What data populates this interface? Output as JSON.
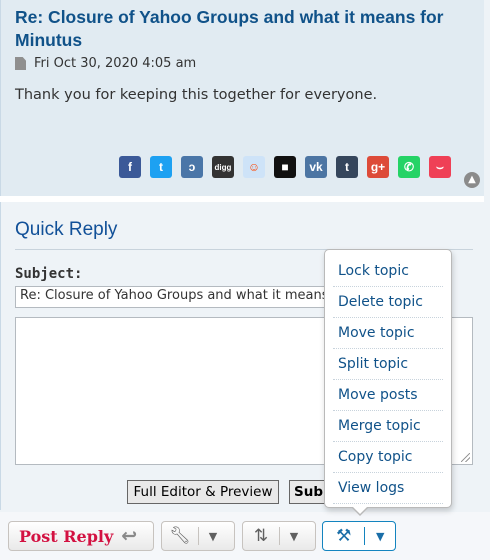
{
  "post": {
    "title": "Re: Closure of Yahoo Groups and what it means for Minutus",
    "date": "Fri Oct 30, 2020 4:05 am",
    "body": "Thank you for keeping this together for everyone."
  },
  "share": [
    {
      "name": "facebook-icon",
      "glyph": "f",
      "color": "#3b5998"
    },
    {
      "name": "twitter-icon",
      "glyph": "t",
      "color": "#1da1f2"
    },
    {
      "name": "tumblr-like-icon",
      "glyph": "ɔ",
      "color": "#4a76a8"
    },
    {
      "name": "digg-icon",
      "glyph": "digg",
      "color": "#333333"
    },
    {
      "name": "reddit-icon",
      "glyph": "☺",
      "color": "#cee3f8"
    },
    {
      "name": "delicious-icon",
      "glyph": "■",
      "color": "#111111"
    },
    {
      "name": "vk-icon",
      "glyph": "vk",
      "color": "#4c75a3"
    },
    {
      "name": "tumblr-icon",
      "glyph": "t",
      "color": "#35465c"
    },
    {
      "name": "google-plus-icon",
      "glyph": "g+",
      "color": "#dd4b39"
    },
    {
      "name": "whatsapp-icon",
      "glyph": "✆",
      "color": "#25d366"
    },
    {
      "name": "pocket-icon",
      "glyph": "⌣",
      "color": "#ef4056"
    }
  ],
  "quick_reply": {
    "title": "Quick Reply",
    "subject_label": "Subject:",
    "subject_value": "Re: Closure of Yahoo Groups and what it means for Minutus",
    "full_editor_label": "Full Editor & Preview",
    "submit_label": "Submit"
  },
  "actions": {
    "post_reply_label": "Post Reply"
  },
  "mod_menu": {
    "items": [
      "Lock topic",
      "Delete topic",
      "Move topic",
      "Split topic",
      "Move posts",
      "Merge topic",
      "Copy topic",
      "View logs"
    ]
  }
}
